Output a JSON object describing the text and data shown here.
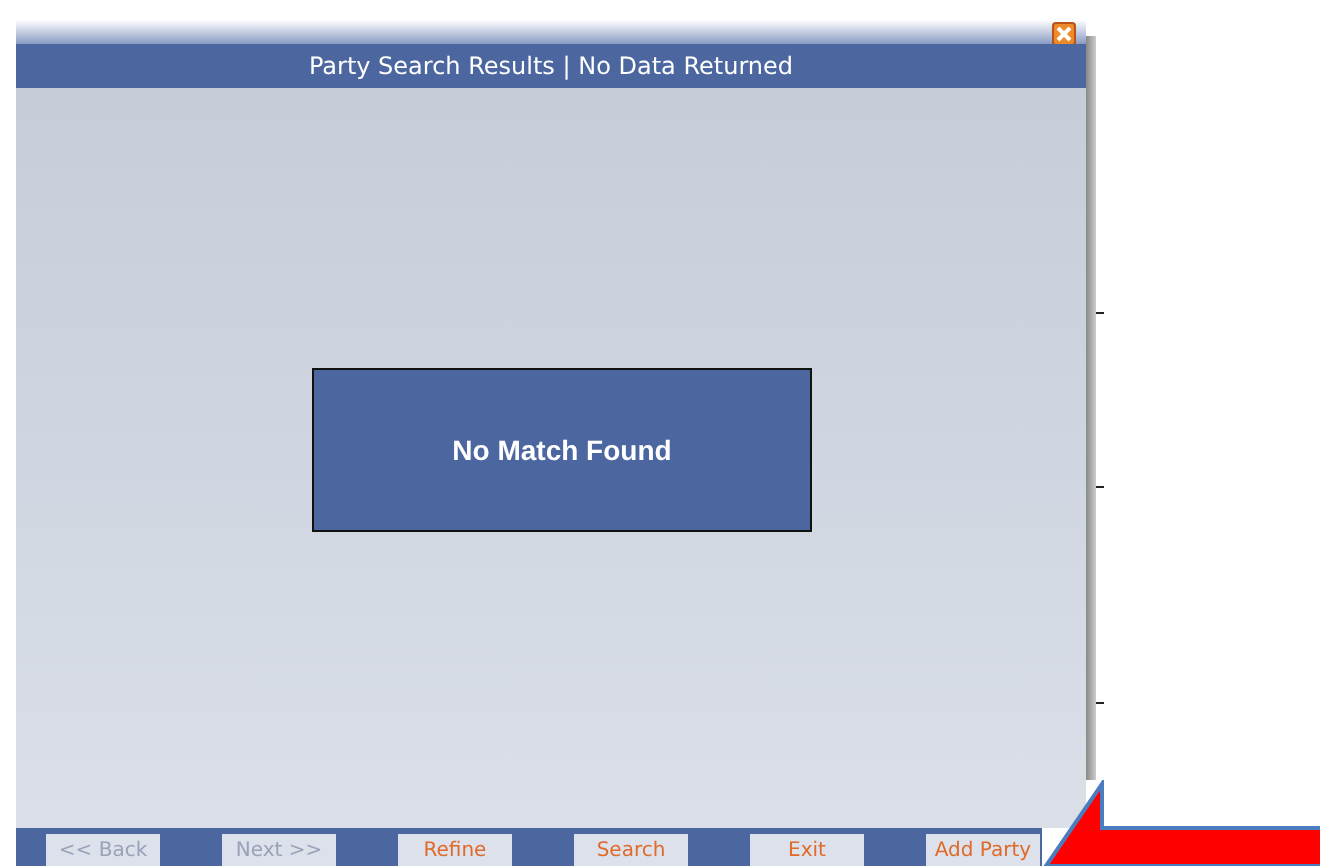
{
  "window": {
    "title": "Party Search Results | No Data Returned"
  },
  "message": "No Match Found",
  "buttons": [
    {
      "label": "<< Back",
      "disabled": true
    },
    {
      "label": "Next >>",
      "disabled": true
    },
    {
      "label": "Refine",
      "disabled": false
    },
    {
      "label": "Search",
      "disabled": false
    },
    {
      "label": "Exit",
      "disabled": false
    },
    {
      "label": "Add Party",
      "disabled": false
    }
  ]
}
